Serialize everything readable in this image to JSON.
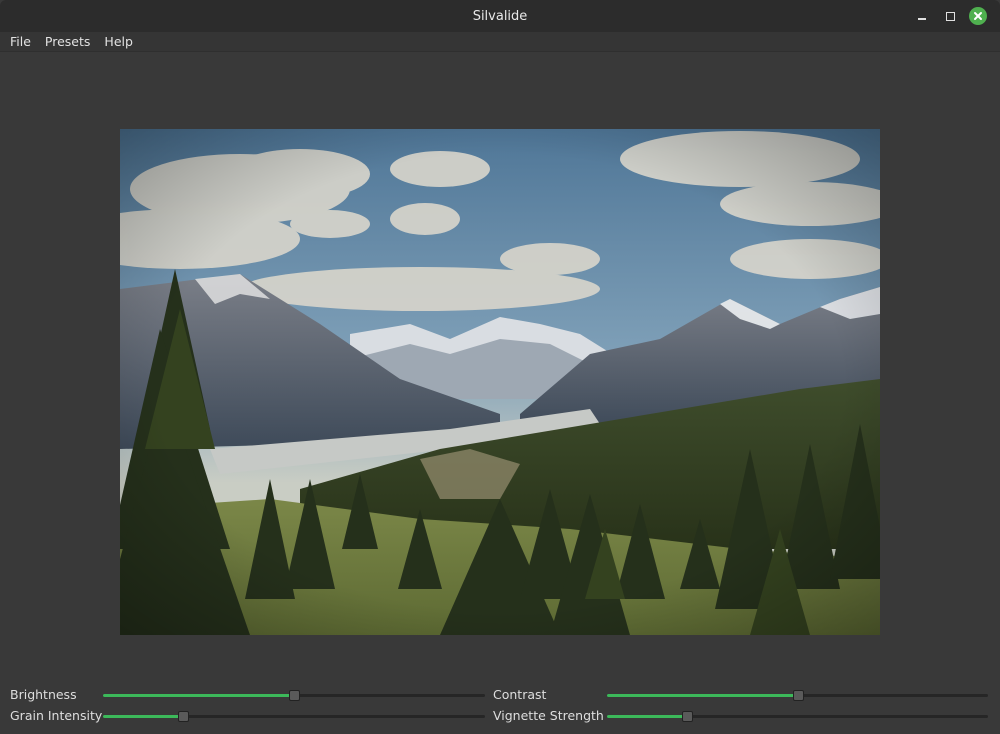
{
  "window": {
    "title": "Silvalide",
    "controls": {
      "minimize": "minimize-icon",
      "maximize": "maximize-icon",
      "close": "close-icon"
    }
  },
  "menu": {
    "items": [
      {
        "label": "File"
      },
      {
        "label": "Presets"
      },
      {
        "label": "Help"
      }
    ]
  },
  "image": {
    "description_icon": "landscape-photo",
    "colors": {
      "sky": "#5f86a8",
      "accent": "#3cb95a"
    }
  },
  "sliders": {
    "brightness": {
      "label": "Brightness",
      "value": 0.5
    },
    "contrast": {
      "label": "Contrast",
      "value": 0.5
    },
    "grain": {
      "label": "Grain Intensity",
      "value": 0.21
    },
    "vignette": {
      "label": "Vignette Strength",
      "value": 0.21
    }
  }
}
